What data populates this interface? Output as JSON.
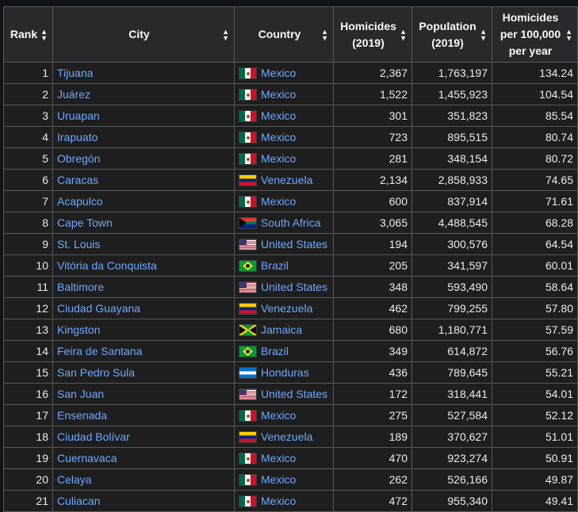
{
  "table": {
    "headers": {
      "rank": "Rank",
      "city": "City",
      "country": "Country",
      "homicides_1": "Homicides",
      "homicides_2": "(2019)",
      "population_1": "Population",
      "population_2": "(2019)",
      "rate_1": "Homicides",
      "rate_2": "per 100,000",
      "rate_3": "per year"
    },
    "sort_icon": "sort-icon",
    "rows": [
      {
        "rank": "1",
        "city": "Tijuana",
        "country": "Mexico",
        "flag": "mexico",
        "homicides": "2,367",
        "population": "1,763,197",
        "rate": "134.24"
      },
      {
        "rank": "2",
        "city": "Juárez",
        "country": "Mexico",
        "flag": "mexico",
        "homicides": "1,522",
        "population": "1,455,923",
        "rate": "104.54"
      },
      {
        "rank": "3",
        "city": "Uruapan",
        "country": "Mexico",
        "flag": "mexico",
        "homicides": "301",
        "population": "351,823",
        "rate": "85.54"
      },
      {
        "rank": "4",
        "city": "Irapuato",
        "country": "Mexico",
        "flag": "mexico",
        "homicides": "723",
        "population": "895,515",
        "rate": "80.74"
      },
      {
        "rank": "5",
        "city": "Obregón",
        "country": "Mexico",
        "flag": "mexico",
        "homicides": "281",
        "population": "348,154",
        "rate": "80.72"
      },
      {
        "rank": "6",
        "city": "Caracas",
        "country": "Venezuela",
        "flag": "venezuela",
        "homicides": "2,134",
        "population": "2,858,933",
        "rate": "74.65"
      },
      {
        "rank": "7",
        "city": "Acapulco",
        "country": "Mexico",
        "flag": "mexico",
        "homicides": "600",
        "population": "837,914",
        "rate": "71.61"
      },
      {
        "rank": "8",
        "city": "Cape Town",
        "country": "South Africa",
        "flag": "south-africa",
        "homicides": "3,065",
        "population": "4,488,545",
        "rate": "68.28"
      },
      {
        "rank": "9",
        "city": "St. Louis",
        "country": "United States",
        "flag": "united-states",
        "homicides": "194",
        "population": "300,576",
        "rate": "64.54"
      },
      {
        "rank": "10",
        "city": "Vitória da Conquista",
        "country": "Brazil",
        "flag": "brazil",
        "homicides": "205",
        "population": "341,597",
        "rate": "60.01"
      },
      {
        "rank": "11",
        "city": "Baltimore",
        "country": "United States",
        "flag": "united-states",
        "homicides": "348",
        "population": "593,490",
        "rate": "58.64"
      },
      {
        "rank": "12",
        "city": "Ciudad Guayana",
        "country": "Venezuela",
        "flag": "venezuela",
        "homicides": "462",
        "population": "799,255",
        "rate": "57.80"
      },
      {
        "rank": "13",
        "city": "Kingston",
        "country": "Jamaica",
        "flag": "jamaica",
        "homicides": "680",
        "population": "1,180,771",
        "rate": "57.59"
      },
      {
        "rank": "14",
        "city": "Feira de Santana",
        "country": "Brazil",
        "flag": "brazil",
        "homicides": "349",
        "population": "614,872",
        "rate": "56.76"
      },
      {
        "rank": "15",
        "city": "San Pedro Sula",
        "country": "Honduras",
        "flag": "honduras",
        "homicides": "436",
        "population": "789,645",
        "rate": "55.21"
      },
      {
        "rank": "16",
        "city": "San Juan",
        "country": "United States",
        "flag": "united-states",
        "homicides": "172",
        "population": "318,441",
        "rate": "54.01"
      },
      {
        "rank": "17",
        "city": "Ensenada",
        "country": "Mexico",
        "flag": "mexico",
        "homicides": "275",
        "population": "527,584",
        "rate": "52.12"
      },
      {
        "rank": "18",
        "city": "Ciudad Bolívar",
        "country": "Venezuela",
        "flag": "venezuela",
        "homicides": "189",
        "population": "370,627",
        "rate": "51.01"
      },
      {
        "rank": "19",
        "city": "Cuernavaca",
        "country": "Mexico",
        "flag": "mexico",
        "homicides": "470",
        "population": "923,274",
        "rate": "50.91"
      },
      {
        "rank": "20",
        "city": "Celaya",
        "country": "Mexico",
        "flag": "mexico",
        "homicides": "262",
        "population": "526,166",
        "rate": "49.87"
      },
      {
        "rank": "21",
        "city": "Culiacan",
        "country": "Mexico",
        "flag": "mexico",
        "homicides": "472",
        "population": "955,340",
        "rate": "49.41"
      }
    ]
  }
}
